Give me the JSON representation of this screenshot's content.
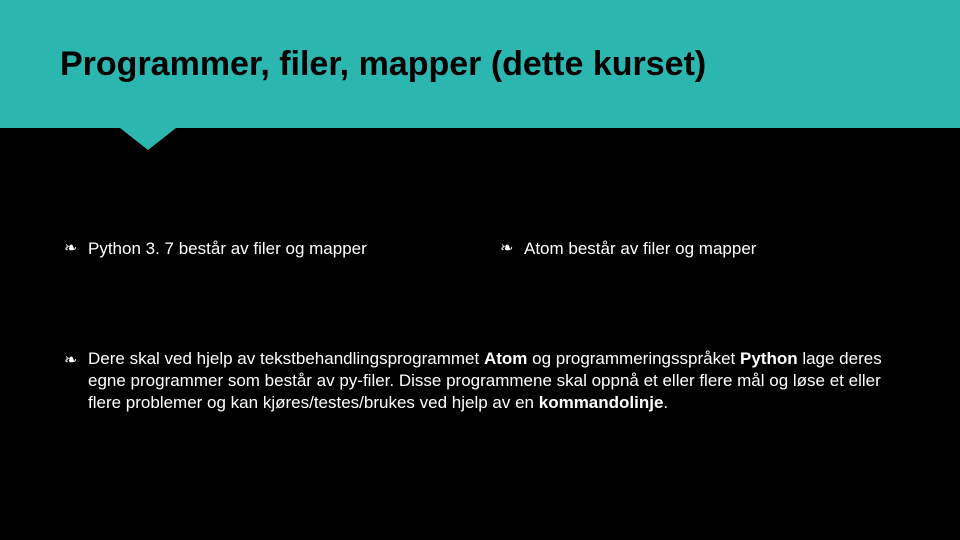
{
  "header": {
    "title": "Programmer, filer, mapper (dette kurset)"
  },
  "bullets": {
    "left": "Python 3. 7 består av filer og mapper",
    "right": "Atom består av filer og mapper"
  },
  "para": {
    "pre1": "Dere skal ved hjelp av tekstbehandlingsprogrammet ",
    "bold1": "Atom",
    "mid1": " og programmeringsspråket ",
    "bold2": "Python",
    "mid2": " lage deres egne programmer som består av py-filer. Disse programmene skal oppnå et eller flere mål og løse et eller flere problemer og kan kjøres/testes/brukes ved hjelp av en ",
    "bold3": "kommandolinje",
    "tail": "."
  },
  "glyph": "❧"
}
